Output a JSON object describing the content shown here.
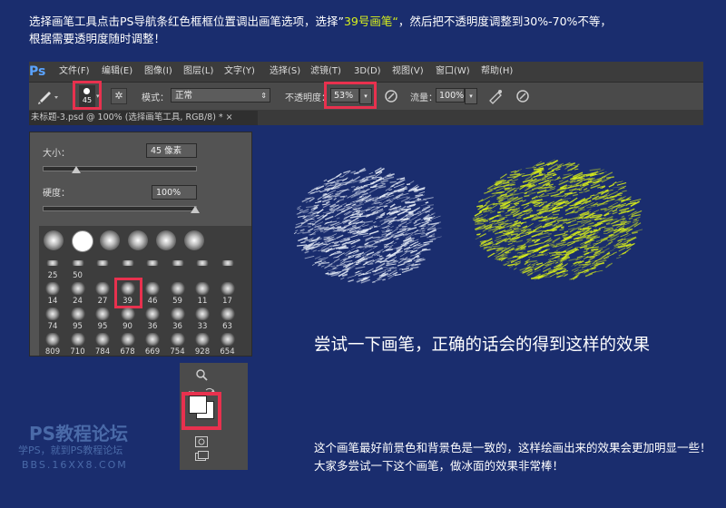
{
  "intro": {
    "line1_a": "选择画笔工具点击PS导航条红色框框位置调出画笔选项，选择”",
    "line1_hl": "39号画笔“",
    "line1_b": "，然后把不透明度调整到30%-70%不等，",
    "line2": "根据需要透明度随时调整！"
  },
  "menubar": {
    "logo": "Ps",
    "items": [
      "文件(F)",
      "编辑(E)",
      "图像(I)",
      "图层(L)",
      "文字(Y)",
      "选择(S)",
      "滤镜(T)",
      "3D(D)",
      "视图(V)",
      "窗口(W)",
      "帮助(H)"
    ]
  },
  "options": {
    "brush_size": "45",
    "mode_label": "模式：",
    "mode_value": "正常",
    "opacity_label": "不透明度：",
    "opacity_value": "53%",
    "flow_label": "流量：",
    "flow_value": "100%"
  },
  "document_tab": "未标题-3.psd @ 100% (选择画笔工具, RGB/8) *  ×",
  "brush_panel": {
    "size_label": "大小：",
    "size_value": "45 像素",
    "size_level": 0.22,
    "hardness_label": "硬度：",
    "hardness_value": "100%",
    "hardness_level": 1.0,
    "rows": [
      [
        "",
        "",
        "",
        "",
        "",
        ""
      ],
      [
        "25",
        "50",
        "",
        "",
        "",
        ""
      ],
      [
        "14",
        "24",
        "27",
        "39",
        "46",
        "59",
        "11",
        "17"
      ],
      [
        "74",
        "95",
        "95",
        "90",
        "36",
        "36",
        "33",
        "63"
      ],
      [
        "809",
        "710",
        "784",
        "678",
        "669",
        "754",
        "928",
        "654"
      ]
    ],
    "selected_brush": "39"
  },
  "tool_panel": {
    "icons": [
      "zoom-icon",
      "swap-colors-icon",
      "foreground-background-icon",
      "quick-mask-icon",
      "screen-mode-icon"
    ]
  },
  "try_text": "尝试一下画笔，正确的话会的得到这样的效果",
  "tip_text": "这个画笔最好前景色和背景色是一致的，这样绘画出来的效果会更加明显一些！大家多尝试一下这个画笔，做冰面的效果非常棒！",
  "watermark": {
    "title": "PS教程论坛",
    "sub": "学PS，就到PS教程论坛",
    "url": "BBS.16XX8.COM"
  },
  "colors": {
    "background": "#1a2d6e",
    "highlight": "#d8f01c",
    "red_frame": "#e8314e",
    "stroke_white": "#e8eef8",
    "stroke_yellow": "#d6ec1a"
  }
}
